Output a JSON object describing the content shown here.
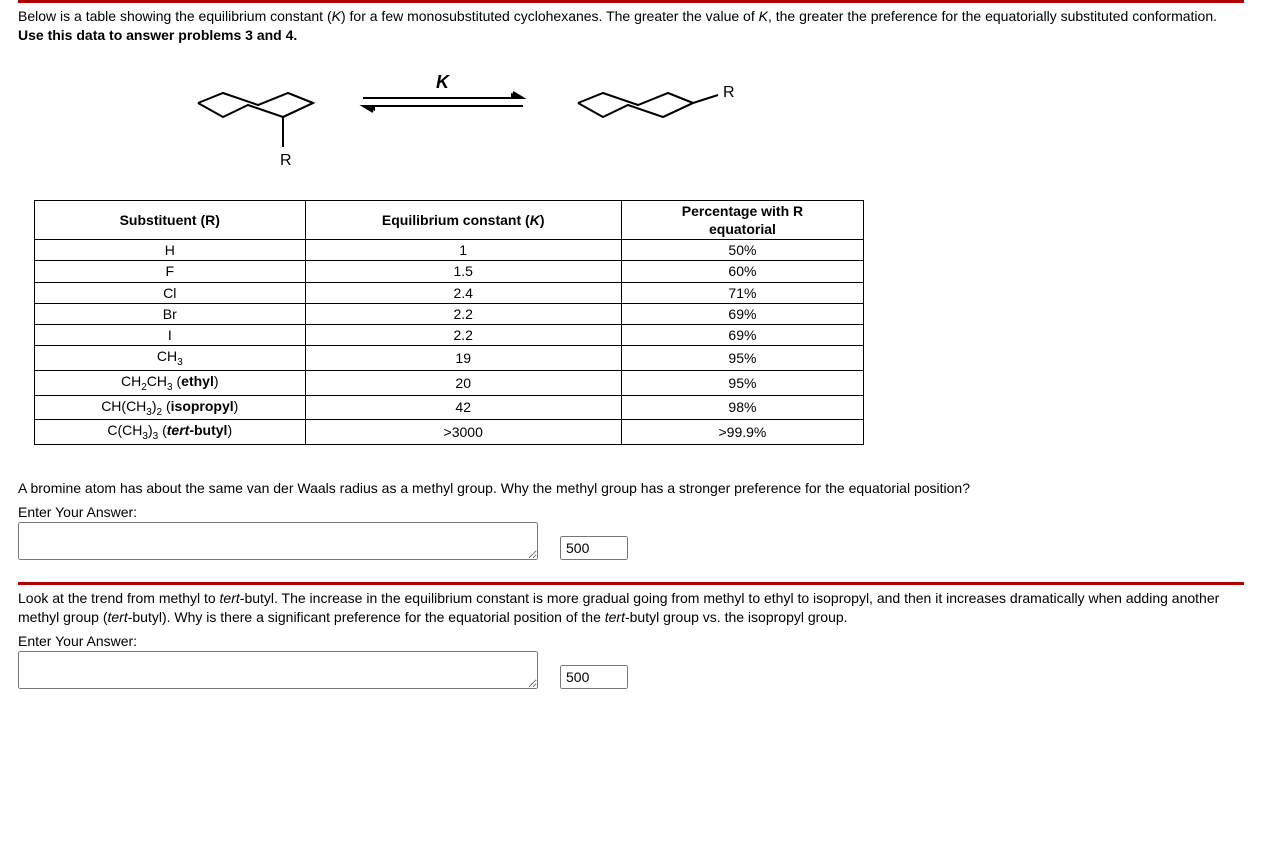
{
  "intro": {
    "part1": "Below is a table showing the equilibrium constant (",
    "k_italic": "K",
    "part2": ") for a few monosubstituted cyclohexanes.  The greater the value of ",
    "part3": ", the greater the preference for the equatorially substituted conformation.  ",
    "bold": "Use this data to answer problems 3 and 4."
  },
  "diagram": {
    "k_label": "K",
    "r1": "R",
    "r2": "R"
  },
  "table": {
    "headers": {
      "col1": "Substituent (R)",
      "col2_a": "Equilibrium constant (",
      "col2_k": "K",
      "col2_b": ")",
      "col3_a": "Percentage with R",
      "col3_b": "equatorial"
    },
    "rows": [
      {
        "sub_html": "H",
        "k": "1",
        "pct": "50%"
      },
      {
        "sub_html": "F",
        "k": "1.5",
        "pct": "60%"
      },
      {
        "sub_html": "Cl",
        "k": "2.4",
        "pct": "71%"
      },
      {
        "sub_html": "Br",
        "k": "2.2",
        "pct": "69%"
      },
      {
        "sub_html": "I",
        "k": "2.2",
        "pct": "69%"
      },
      {
        "sub_html": "CH<span class='sub'>3</span>",
        "k": "19",
        "pct": "95%"
      },
      {
        "sub_html": "CH<span class='sub'>2</span>CH<span class='sub'>3</span> (<b>ethyl</b>)",
        "k": "20",
        "pct": "95%"
      },
      {
        "sub_html": "CH(CH<span class='sub'>3</span>)<span class='sub'>2</span> (<b>isopropyl</b>)",
        "k": "42",
        "pct": "98%"
      },
      {
        "sub_html": "C(CH<span class='sub'>3</span>)<span class='sub'>3</span> (<b><i>tert</i>-butyl</b>)",
        "k": ">3000",
        "pct": ">99.9%"
      }
    ]
  },
  "q1": {
    "text": "A bromine atom has about the same van der Waals radius as a methyl group.  Why the methyl group has a stronger preference for the equatorial position?",
    "enter": "Enter Your Answer:",
    "counter": "500"
  },
  "q2": {
    "part1": "Look at the trend from methyl to ",
    "tert1": "tert",
    "part2": "-butyl.  The increase in the equilibrium constant is more gradual going from methyl to ethyl to isopropyl, and then it increases dramatically when adding another methyl group (",
    "tert2": "tert",
    "part3": "-butyl).  Why is there a significant preference for the equatorial position of the ",
    "tert3": "tert",
    "part4": "-butyl group vs. the isopropyl group.",
    "enter": "Enter Your Answer:",
    "counter": "500"
  }
}
